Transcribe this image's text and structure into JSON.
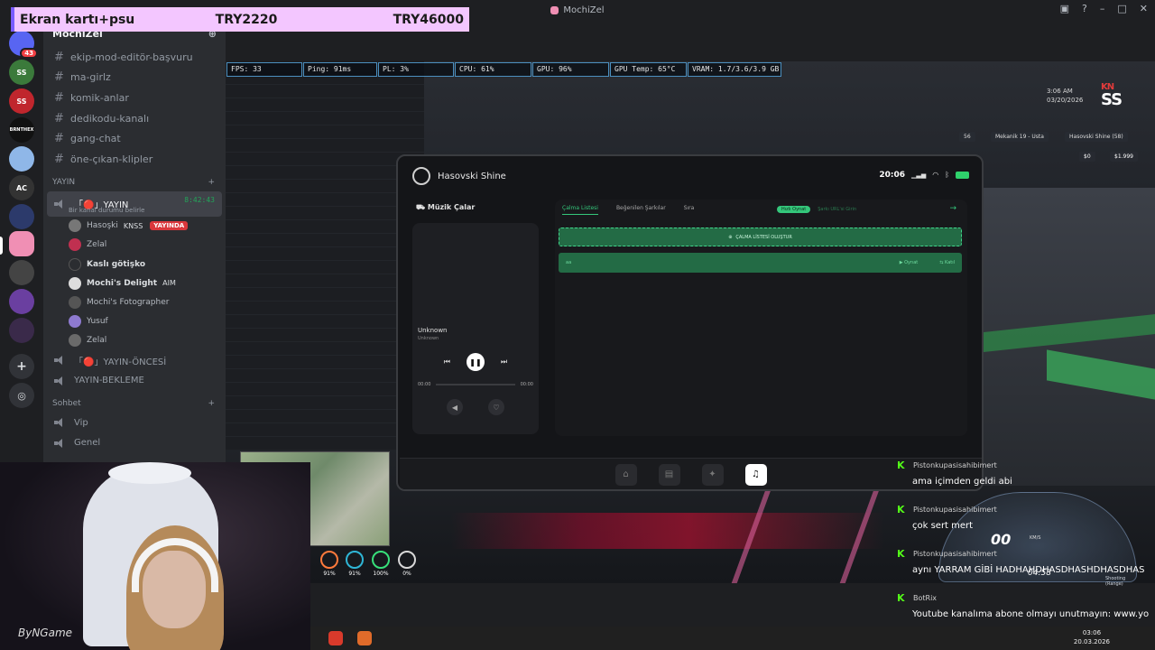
{
  "window": {
    "title": "MochiZel"
  },
  "banner": {
    "item": "Ekran kartı+psu",
    "current": "TRY2220",
    "goal": "TRY46000"
  },
  "rail": {
    "badge": "43",
    "servers": [
      "SS",
      "SS",
      "BRNTHEX",
      "AC"
    ]
  },
  "sidebar": {
    "server_name": "MochiZel",
    "text_channels": [
      "ekip-mod-editör-başvuru",
      "ma-girlz",
      "komik-anlar",
      "dedikodu-kanalı",
      "gang-chat",
      "öne-çıkan-klipler"
    ],
    "voice_category": "YAYIN",
    "active_voice": {
      "name": "「🔴」YAYIN",
      "time": "8:42:43",
      "status": "Bir kanal durumu belirle"
    },
    "members": [
      {
        "name": "Hasoşki",
        "tag": "KNSS",
        "live": "YAYINDA"
      },
      {
        "name": "Zelal",
        "tag": ""
      },
      {
        "name": "Kaslı götişko",
        "tag": ""
      },
      {
        "name": "Mochi's Delight",
        "tag": "AIM"
      },
      {
        "name": "Mochi's Fotographer",
        "tag": ""
      },
      {
        "name": "Yusuf",
        "tag": ""
      },
      {
        "name": "Zelal",
        "tag": ""
      }
    ],
    "voice_channels": [
      "「🔴」YAYIN-ÖNCESİ",
      "YAYIN-BEKLEME"
    ],
    "chat_category": "Sohbet",
    "chat_channels": [
      "Vip",
      "Genel"
    ]
  },
  "perf": [
    "FPS: 33",
    "Ping: 91ms",
    "PL: 3%",
    "CPU: 61%",
    "GPU: 96%",
    "GPU Temp: 65°C",
    "VRAM: 1.7/3.6/3.9 GB"
  ],
  "hud": {
    "time": "3:06 AM",
    "date": "03/20/2026",
    "logo_top": "KN",
    "logo_bottom": "SS",
    "pills": [
      "56",
      "Mekanik 19 - Usta",
      "Hasovski Shine (58)"
    ],
    "cash": "$0",
    "bank": "$1.999"
  },
  "app": {
    "user": "Hasovski Shine",
    "clock": "20:06",
    "section": "Müzik Çalar",
    "track": {
      "title": "Unknown",
      "artist": "Unknown",
      "time_start": "00:00",
      "time_end": "00:00"
    },
    "tabs": [
      "Çalma Listesi",
      "Beğenilen Şarkılar",
      "Sıra"
    ],
    "quick_play": "Hızlı Oynat",
    "url_play": "Şarkı URL'si Girin",
    "create_playlist": "ÇALMA LİSTESİ OLUŞTUR",
    "playlist_row": {
      "name": "aa",
      "play": "Oynat",
      "edit": "Katıl"
    }
  },
  "status_bars": [
    {
      "value": "91%",
      "color": "#ff7a3c"
    },
    {
      "value": "91%",
      "color": "#2fb6d6"
    },
    {
      "value": "100%",
      "color": "#37e07a"
    },
    {
      "value": "0%",
      "color": "#d8d8d8"
    }
  ],
  "speedometer": {
    "speed": "00",
    "unit": "KM/S",
    "odo": "04:58",
    "mode": "Shooting (Range)"
  },
  "chat": [
    {
      "user": "Pistonkupasisahibimert",
      "text": "ama içimden geldi abi"
    },
    {
      "user": "Pistonkupasisahibimert",
      "text": "çok sert mert"
    },
    {
      "user": "Pistonkupasisahibimert",
      "text": "aynı YARRAM GİBİ HADHAHDHASDHASHDHASDHAS"
    },
    {
      "user": "BotRix",
      "text": "Youtube kanalıma abone olmayı unutmayın: www.yo"
    }
  ],
  "webcam": {
    "logo": "ByNGame"
  },
  "taskbar": {
    "time": "03:06",
    "date": "20.03.2026"
  }
}
